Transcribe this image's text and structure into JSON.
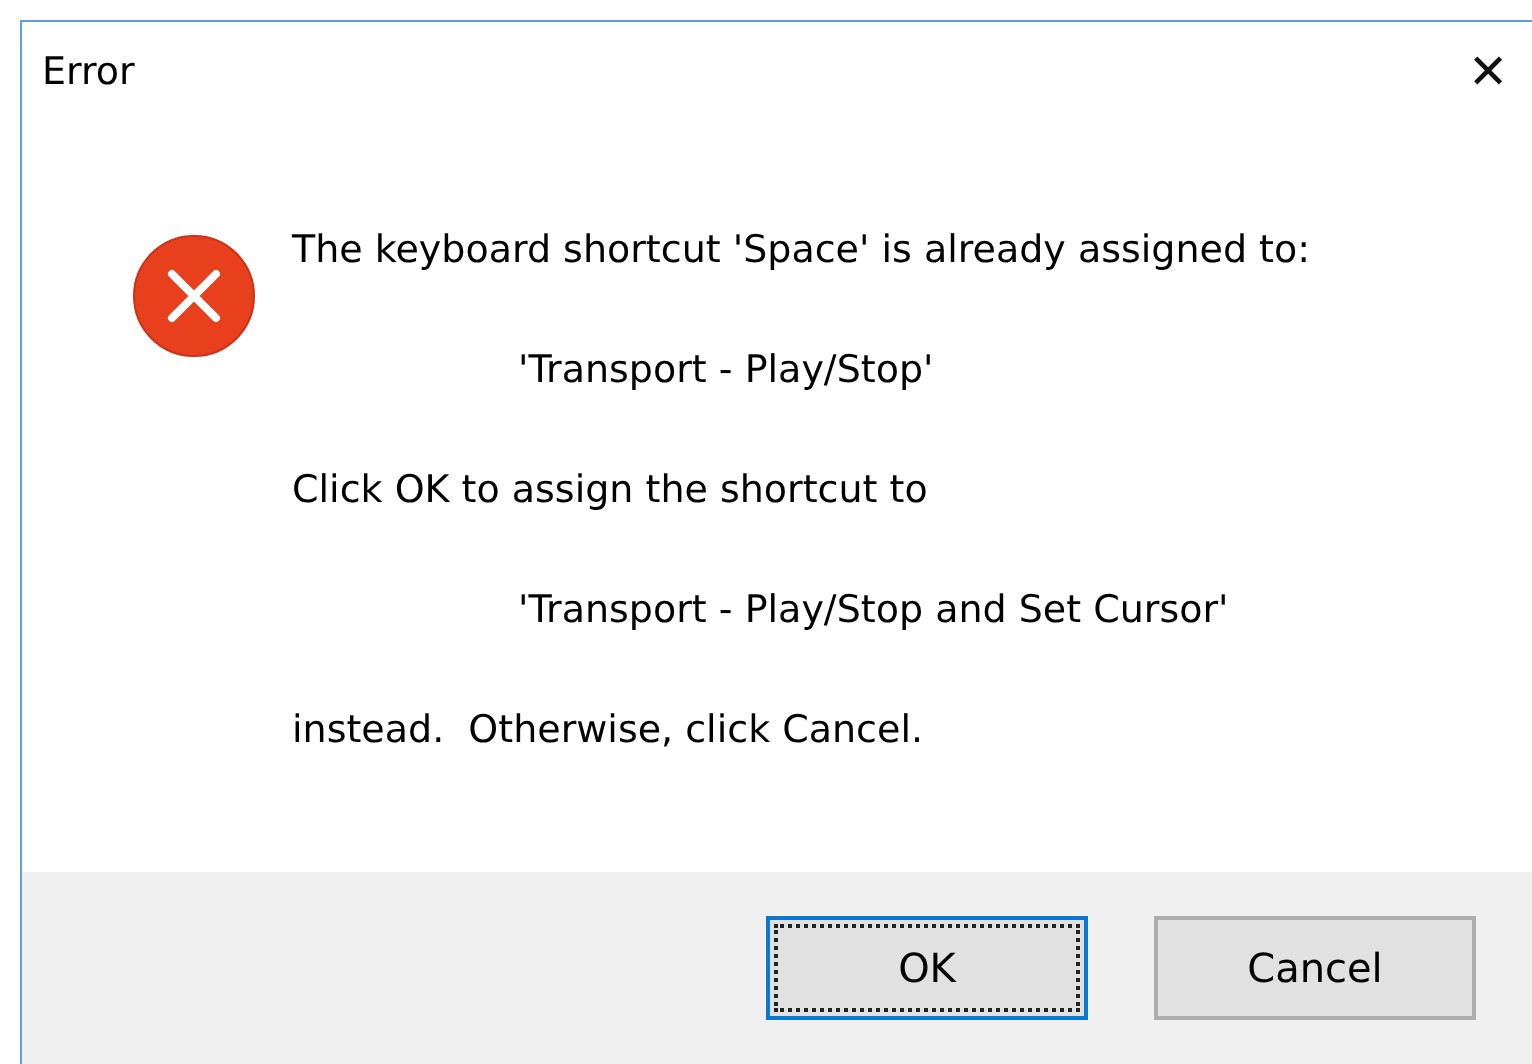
{
  "window": {
    "title": "Error",
    "close": "✕"
  },
  "message": [
    {
      "kind": "plain",
      "text": "The keyboard shortcut 'Space' is already assigned to:"
    },
    {
      "kind": "indented",
      "text": "'Transport - Play/Stop'"
    },
    {
      "kind": "plain",
      "text": "Click OK to assign the shortcut to"
    },
    {
      "kind": "indented",
      "text": "'Transport - Play/Stop and Set Cursor'"
    },
    {
      "kind": "plain",
      "text": "instead.  Otherwise, click Cancel."
    }
  ],
  "buttons": [
    {
      "label": "OK",
      "selected": true
    },
    {
      "label": "Cancel",
      "selected": false
    }
  ]
}
